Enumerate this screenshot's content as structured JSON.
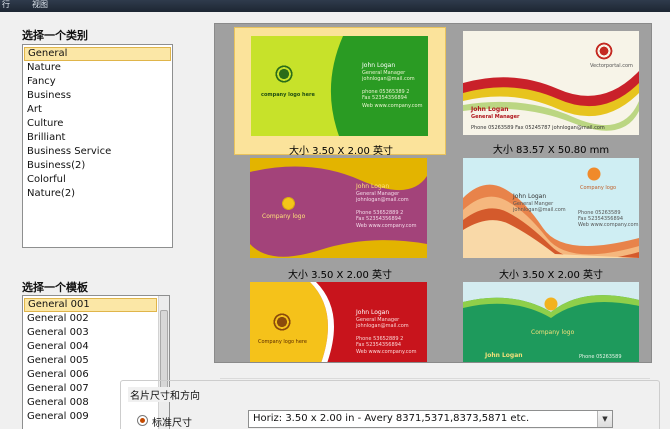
{
  "menubar": {
    "item_1": "行",
    "item_2": "视图"
  },
  "category": {
    "title": "选择一个类别",
    "items": [
      "General",
      "Nature",
      "Fancy",
      "Business",
      "Art",
      "Culture",
      "Brilliant",
      "Business Service",
      "Business(2)",
      "Colorful",
      "Nature(2)"
    ],
    "selected_index": 0
  },
  "template": {
    "title": "选择一个模板",
    "items": [
      "General 001",
      "General 002",
      "General 003",
      "General 004",
      "General 005",
      "General 006",
      "General 007",
      "General 008",
      "General 009"
    ],
    "selected_index": 0
  },
  "gallery": {
    "cards": [
      {
        "size": "大小 3.50 X 2.00 英寸",
        "logo": "company logo here",
        "name": "John Logan",
        "role": "General Manager",
        "email": "johnlogan@mail.com",
        "phone": "phone 05365389 2",
        "fax": "Fax 52354356894",
        "web": "Web www.company.com"
      },
      {
        "size": "大小 83.57 X 50.80 mm",
        "logo": "Vectorportal.com",
        "name": "John Logan",
        "role": "General Manager",
        "contact": "Phone 05263589 Fax 05245787 johnlogan@mail.com"
      },
      {
        "size": "大小 3.50 X 2.00 英寸",
        "logo": "Company logo",
        "name": "John Logan",
        "role": "General Manager",
        "email": "johnlogan@mail.com",
        "phone": "Phone 53652889 2",
        "fax": "Fax 52354356894",
        "web": "Web www.company.com"
      },
      {
        "size": "大小 3.50 X 2.00 英寸",
        "logo": "Company logo",
        "name": "John Logan",
        "role": "General Manger",
        "email": "johnlogan@mail.com",
        "phone": "Phone 05263589",
        "fax": "Fax 52354356894",
        "web": "Web www.company.com"
      },
      {
        "logo": "Company logo here",
        "name": "John Logan",
        "role": "General Manager",
        "email": "johnlogan@mail.com",
        "phone": "Phone 53652889 2",
        "fax": "Fax 52354356894",
        "web": "Web www.company.com"
      },
      {
        "logo": "Company logo",
        "name": "John Logan",
        "phone": "Phone 05263589"
      }
    ]
  },
  "layout_options": {
    "group_title": "名片尺寸和方向",
    "radio_label": "标准尺寸",
    "size_combo_value": "Horiz: 3.50 x 2.00 in - Avery 8371,5371,8373,5871 etc."
  },
  "colors": {
    "selection": "#fbe7a6",
    "gallery_bg": "#a0a0a0"
  }
}
